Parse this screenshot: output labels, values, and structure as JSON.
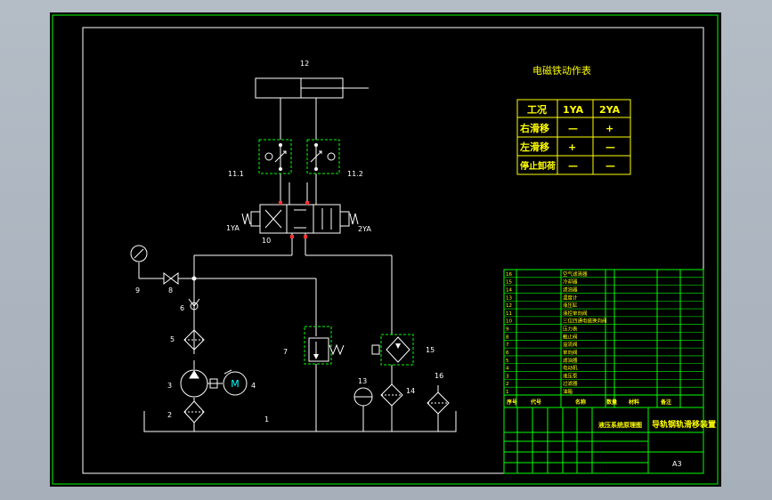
{
  "drawing": {
    "cylinder_label": "12",
    "lock_left_label": "11.1",
    "lock_right_label": "11.2",
    "valve_label": "10",
    "solenoid_left_label": "1YA",
    "solenoid_right_label": "2YA",
    "gauge_label": "9",
    "stop_valve_label": "8",
    "check_valve_label": "6",
    "filter_label": "5",
    "pump_label": "3",
    "motor_label": "4",
    "motor_symbol": "M",
    "suction_filter_label": "2",
    "tank_label": "1",
    "relief_valve_label": "7",
    "cooler_label": "15",
    "thermometer_label": "13",
    "return_filter_label": "14",
    "air_filter_label": "16"
  },
  "action_table": {
    "title": "电磁铁动作表",
    "headers": [
      "工况",
      "1YA",
      "2YA"
    ],
    "rows": [
      {
        "mode": "右滑移",
        "ya1": "—",
        "ya2": "+"
      },
      {
        "mode": "左滑移",
        "ya1": "+",
        "ya2": "—"
      },
      {
        "mode": "停止卸荷",
        "ya1": "—",
        "ya2": "—"
      }
    ]
  },
  "parts_list": {
    "numbers": [
      "16",
      "15",
      "14",
      "13",
      "12",
      "11",
      "10",
      "9",
      "8",
      "7",
      "6",
      "5",
      "4",
      "3",
      "2",
      "1"
    ],
    "names": [
      "空气滤清器",
      "冷却器",
      "滤油器",
      "温度计",
      "液压缸",
      "液控单向阀",
      "三位四通电磁换向阀",
      "压力表",
      "截止阀",
      "溢流阀",
      "单向阀",
      "滤油器",
      "电动机",
      "液压泵",
      "过滤器",
      "油箱"
    ],
    "header": [
      "序号",
      "代号",
      "名称",
      "数量",
      "材料",
      "备注"
    ]
  },
  "title_block": {
    "drawing_name": "液压系统原理图",
    "company": "导轨钢轨滑移装置",
    "size": "A3"
  }
}
